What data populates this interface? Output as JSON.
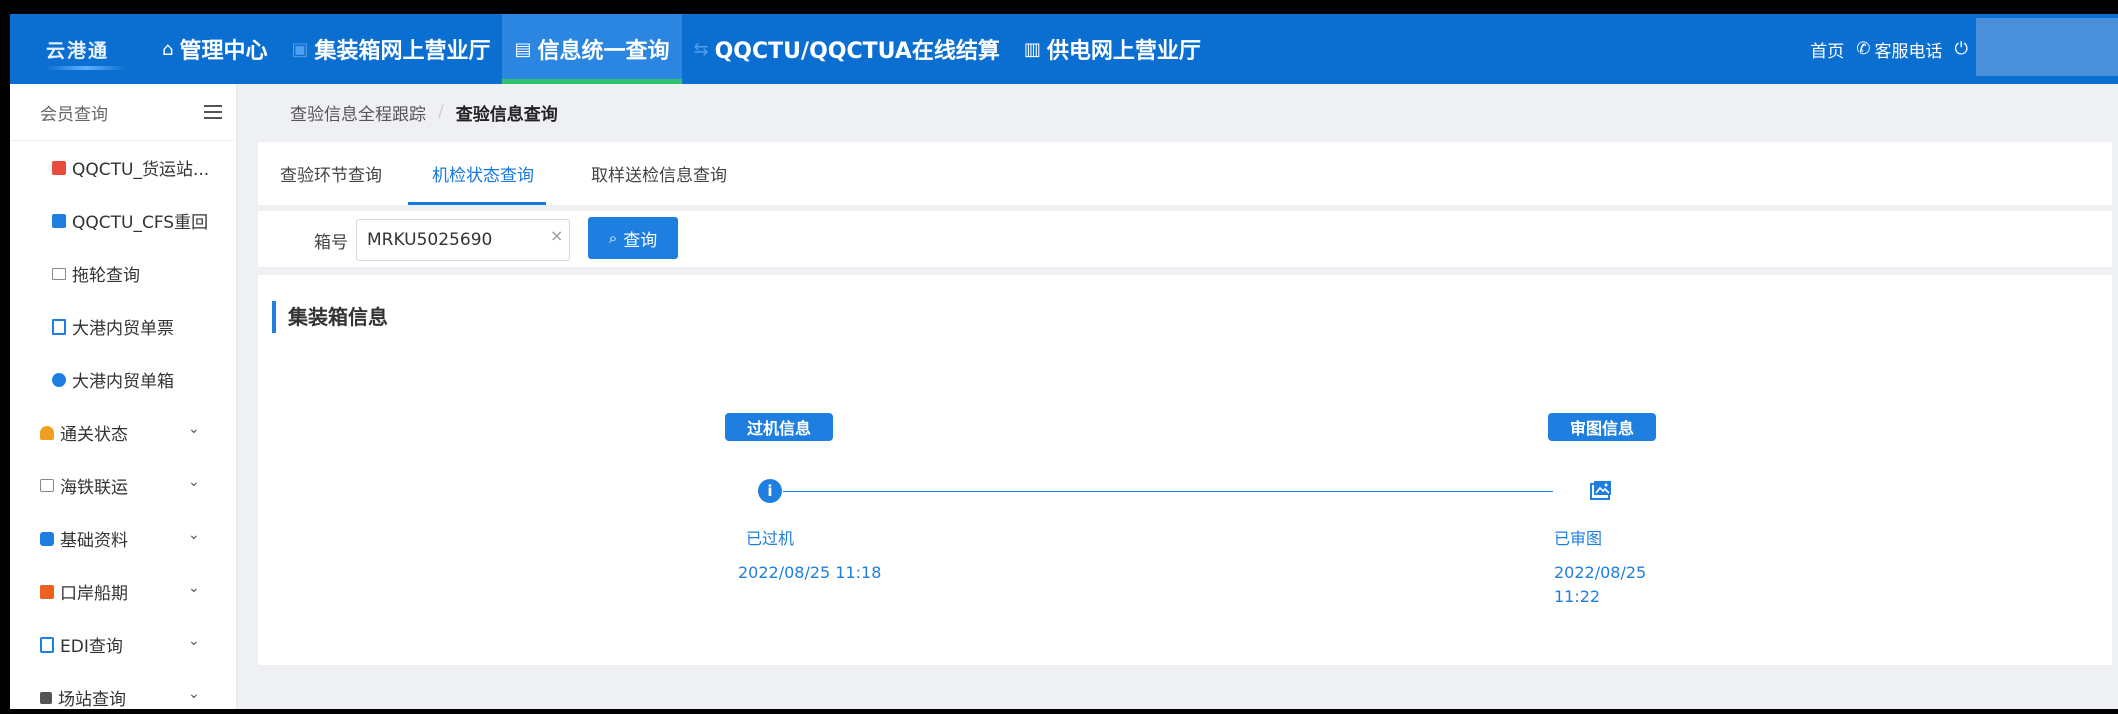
{
  "topbar": {
    "logo": "云港通",
    "nav": [
      {
        "icon": "home-icon",
        "label": "管理中心"
      },
      {
        "icon": "container-icon",
        "label": "集装箱网上营业厅"
      },
      {
        "icon": "document-icon",
        "label": "信息统一查询",
        "active": true
      },
      {
        "icon": "exchange-icon",
        "label": "QQCTU/QQCTUA在线结算"
      },
      {
        "icon": "clipboard-icon",
        "label": "供电网上营业厅"
      }
    ],
    "right": {
      "home": "首页",
      "service": "客服电话"
    }
  },
  "sidebar": {
    "title": "会员查询",
    "items": [
      {
        "label": "QQCTU_货运站...",
        "icon": "report-icon",
        "color": "#e74c3c",
        "level": "sub"
      },
      {
        "label": "QQCTU_CFS重回",
        "icon": "calendar-icon",
        "color": "#1e7fe0",
        "level": "sub"
      },
      {
        "label": "拖轮查询",
        "icon": "ship-icon",
        "color": "#888888",
        "level": "sub"
      },
      {
        "label": "大港内贸单票",
        "icon": "clipboard-icon",
        "color": "#1e7fe0",
        "level": "sub"
      },
      {
        "label": "大港内贸单箱",
        "icon": "globe-icon",
        "color": "#1e7fe0",
        "level": "sub"
      },
      {
        "label": "通关状态",
        "icon": "customs-icon",
        "color": "#f0a020",
        "level": "top"
      },
      {
        "label": "海铁联运",
        "icon": "train-icon",
        "color": "#888888",
        "level": "top"
      },
      {
        "label": "基础资料",
        "icon": "database-icon",
        "color": "#1e7fe0",
        "level": "top"
      },
      {
        "label": "口岸船期",
        "icon": "schedule-icon",
        "color": "#f06020",
        "level": "top"
      },
      {
        "label": "EDI查询",
        "icon": "edi-icon",
        "color": "#1e7fe0",
        "level": "top"
      },
      {
        "label": "场站查询",
        "icon": "yard-icon",
        "color": "#555555",
        "level": "top"
      }
    ]
  },
  "breadcrumb": {
    "parent": "查验信息全程跟踪",
    "sep": "/",
    "current": "查验信息查询"
  },
  "tabs": [
    {
      "label": "查验环节查询"
    },
    {
      "label": "机检状态查询",
      "active": true
    },
    {
      "label": "取样送检信息查询"
    }
  ],
  "search": {
    "label": "箱号",
    "value": "MRKU5025690",
    "clear": "×",
    "button": "查询"
  },
  "panel": {
    "title": "集装箱信息",
    "events": [
      {
        "badge": "过机信息",
        "icon": "info-icon",
        "glyph": "i",
        "status": "已过机",
        "time": "2022/08/25 11:18"
      },
      {
        "badge": "审图信息",
        "icon": "image-icon",
        "status": "已审图",
        "time_date": "2022/08/25",
        "time_clock": "11:22"
      }
    ]
  },
  "colors": {
    "primary": "#1e7fe0",
    "topbar": "#0b6fd1",
    "active_underline": "#2fc26f"
  }
}
